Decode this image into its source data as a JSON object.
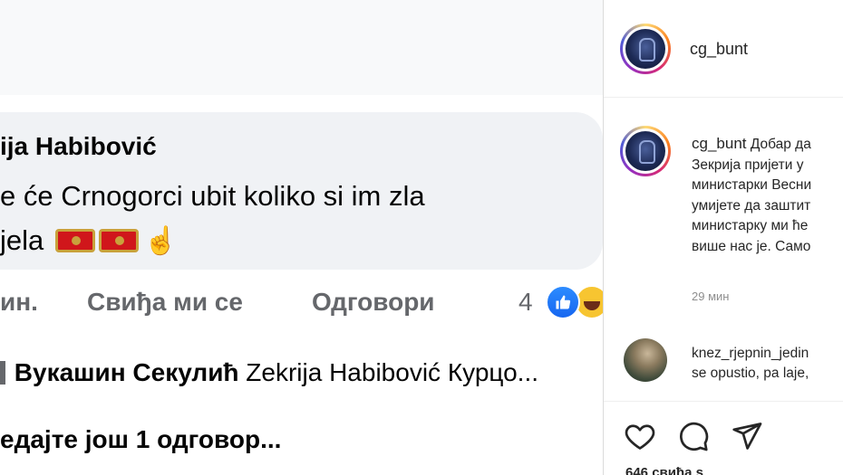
{
  "post_image": {
    "comment_author": "ija Habibović",
    "comment_lines": [
      "e će Crnogorci ubit  koliko si im zla",
      "jela"
    ],
    "emoji_flags": [
      "montenegro-flag-icon",
      "montenegro-flag-icon"
    ],
    "emoji_hand": "☝",
    "actions": {
      "time": "ин.",
      "like": "Свиђа ми се",
      "reply": "Одговори",
      "reaction_count": "4"
    },
    "reply": {
      "author": "Вукашин Секулић",
      "text": "Zekrija Habibović Курцо..."
    },
    "more_replies": "едајте још 1 одговор..."
  },
  "instagram": {
    "header_username": "cg_bunt",
    "caption": {
      "username": "cg_bunt",
      "lines": [
        "Добар да",
        "Зекрија пријети у",
        "министарки Весни",
        "умијете да заштит",
        "министарку ми ћe",
        "више нас је. Само"
      ]
    },
    "timestamp": "29 мин",
    "comment": {
      "username": "knez_rjepnin_jedin",
      "text": "se opustio, pa laje,"
    },
    "likes": "646 свиђа s"
  },
  "colors": {
    "facebook_bubble": "#f0f2f5",
    "facebook_secondary_text": "#65676b",
    "facebook_like_blue": "#1877f2",
    "instagram_text": "#262626",
    "instagram_muted": "#8e8e8e"
  }
}
